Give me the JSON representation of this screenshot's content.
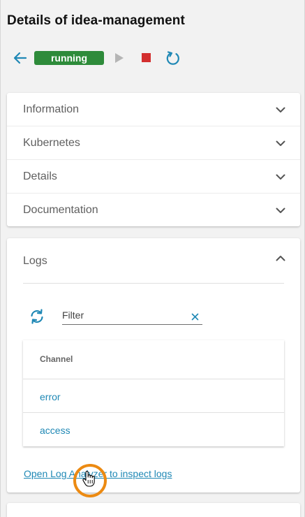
{
  "page": {
    "title": "Details of idea-management"
  },
  "toolbar": {
    "back_icon": "arrow-left-icon",
    "status": "running",
    "status_color": "#2e8b3a",
    "play_icon": "play-icon",
    "stop_icon": "stop-icon",
    "stop_color": "#d32f2f",
    "restart_icon": "restart-icon",
    "accent_color": "#1f88b5"
  },
  "panels": [
    {
      "label": "Information",
      "expanded": false
    },
    {
      "label": "Kubernetes",
      "expanded": false
    },
    {
      "label": "Details",
      "expanded": false
    },
    {
      "label": "Documentation",
      "expanded": false
    }
  ],
  "logs": {
    "label": "Logs",
    "expanded": true,
    "refresh_icon": "sync-icon",
    "filter": {
      "value": "",
      "placeholder": "Filter",
      "clear_icon": "close-icon"
    },
    "table": {
      "columns": [
        "Channel"
      ],
      "rows": [
        {
          "channel": "error"
        },
        {
          "channel": "access"
        }
      ]
    },
    "analyzer_link": "Open Log Analyzer to inspect logs"
  }
}
